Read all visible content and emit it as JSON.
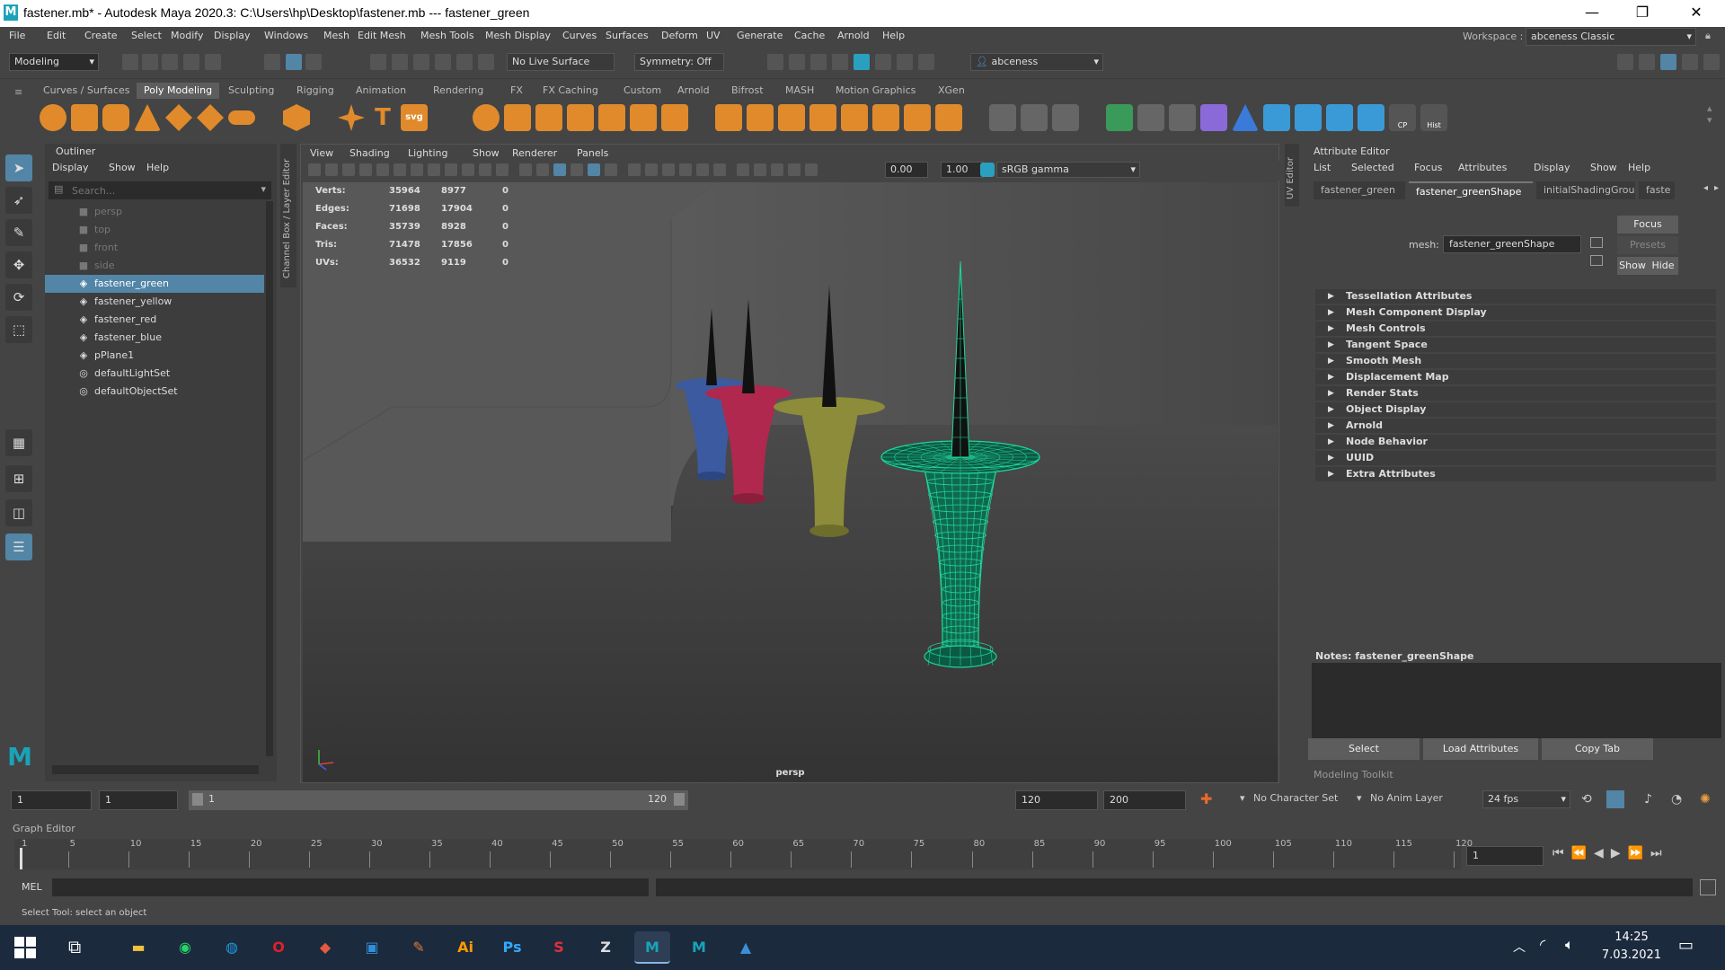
{
  "title_bar": {
    "logo_letter": "M",
    "title": "fastener.mb* - Autodesk Maya 2020.3: C:\\Users\\hp\\Desktop\\fastener.mb   ---   fastener_green",
    "minimize": "—",
    "maximize": "❐",
    "close": "✕"
  },
  "menubar": [
    "File",
    "Edit",
    "Create",
    "Select",
    "Modify",
    "Display",
    "Windows",
    "Mesh",
    "Edit Mesh",
    "Mesh Tools",
    "Mesh Display",
    "Curves",
    "Surfaces",
    "Deform",
    "UV",
    "Generate",
    "Cache",
    "Arnold",
    "Help"
  ],
  "workspace": {
    "label": "Workspace :",
    "value": "abceness Classic"
  },
  "status_line": {
    "mode": "Modeling",
    "live_surface": "No Live Surface",
    "symmetry": "Symmetry: Off",
    "user": "abceness"
  },
  "shelf_tabs": [
    "Curves / Surfaces",
    "Poly Modeling",
    "Sculpting",
    "Rigging",
    "Animation",
    "Rendering",
    "FX",
    "FX Caching",
    "Custom",
    "Arnold",
    "Bifrost",
    "MASH",
    "Motion Graphics",
    "XGen"
  ],
  "shelf_active": "Poly Modeling",
  "shelf_labels": {
    "cp": "CP",
    "hist": "Hist",
    "svg": "svg",
    "text": "T"
  },
  "side_labels": {
    "channel_box": "Channel Box / Layer Editor",
    "uv_editor": "UV Editor"
  },
  "outliner": {
    "title": "Outliner",
    "menu": [
      "Display",
      "Show",
      "Help"
    ],
    "search_placeholder": "Search...",
    "items": [
      {
        "label": "persp",
        "type": "camera"
      },
      {
        "label": "top",
        "type": "camera"
      },
      {
        "label": "front",
        "type": "camera"
      },
      {
        "label": "side",
        "type": "camera"
      },
      {
        "label": "fastener_green",
        "type": "mesh",
        "selected": true
      },
      {
        "label": "fastener_yellow",
        "type": "mesh"
      },
      {
        "label": "fastener_red",
        "type": "mesh"
      },
      {
        "label": "fastener_blue",
        "type": "mesh"
      },
      {
        "label": "pPlane1",
        "type": "mesh"
      },
      {
        "label": "defaultLightSet",
        "type": "set"
      },
      {
        "label": "defaultObjectSet",
        "type": "set"
      }
    ]
  },
  "viewport": {
    "menu": [
      "View",
      "Shading",
      "Lighting",
      "Show",
      "Renderer",
      "Panels"
    ],
    "exposure": "0.00",
    "gamma": "1.00",
    "color_space": "sRGB gamma",
    "camera_label": "persp",
    "hud": [
      {
        "label": "Verts:",
        "a": "35964",
        "b": "8977",
        "c": "0"
      },
      {
        "label": "Edges:",
        "a": "71698",
        "b": "17904",
        "c": "0"
      },
      {
        "label": "Faces:",
        "a": "35739",
        "b": "8928",
        "c": "0"
      },
      {
        "label": "Tris:",
        "a": "71478",
        "b": "17856",
        "c": "0"
      },
      {
        "label": "UVs:",
        "a": "36532",
        "b": "9119",
        "c": "0"
      }
    ],
    "fastener_colors": {
      "blue": "#3c5aa0",
      "red": "#b0284e",
      "yellow": "#8c8c3a",
      "green": "#22d49a"
    }
  },
  "attribute_editor": {
    "title": "Attribute Editor",
    "menu": [
      "List",
      "Selected",
      "Focus",
      "Attributes",
      "Display",
      "Show",
      "Help"
    ],
    "tabs": [
      "fastener_green",
      "fastener_greenShape",
      "initialShadingGroup",
      "faste"
    ],
    "active_tab": "fastener_greenShape",
    "mesh_label": "mesh:",
    "mesh_value": "fastener_greenShape",
    "focus": "Focus",
    "presets": "Presets",
    "show": "Show",
    "hide": "Hide",
    "sections": [
      "Tessellation Attributes",
      "Mesh Component Display",
      "Mesh Controls",
      "Tangent Space",
      "Smooth Mesh",
      "Displacement Map",
      "Render Stats",
      "Object Display",
      "Arnold",
      "Node Behavior",
      "UUID",
      "Extra Attributes"
    ],
    "notes_label": "Notes:  fastener_greenShape",
    "buttons": [
      "Select",
      "Load Attributes",
      "Copy Tab"
    ],
    "modeling_toolkit": "Modeling Toolkit"
  },
  "time_slider": {
    "start": "1",
    "current_start": "1",
    "range_start": "1",
    "range_end_inner": "120",
    "range_end": "120",
    "anim_end": "200",
    "character_set": "No Character Set",
    "anim_layer": "No Anim Layer",
    "fps": "24 fps"
  },
  "graph_editor": {
    "label": "Graph Editor",
    "ticks": [
      "1",
      "5",
      "10",
      "15",
      "20",
      "25",
      "30",
      "35",
      "40",
      "45",
      "50",
      "55",
      "60",
      "65",
      "70",
      "75",
      "80",
      "85",
      "90",
      "95",
      "100",
      "105",
      "110",
      "115",
      "120"
    ],
    "current_frame": "1"
  },
  "command_line": {
    "label": "MEL"
  },
  "help_line": "Select Tool: select an object",
  "taskbar": {
    "time": "14:25",
    "date": "7.03.2021",
    "apps": [
      {
        "name": "file-explorer",
        "glyph": "▬",
        "color": "#f3c13a"
      },
      {
        "name": "whatsapp",
        "glyph": "◉",
        "color": "#25d366"
      },
      {
        "name": "edge",
        "glyph": "◍",
        "color": "#1e9be0"
      },
      {
        "name": "opera",
        "glyph": "O",
        "color": "#e0202a"
      },
      {
        "name": "sketch-app",
        "glyph": "◆",
        "color": "#e55a3c"
      },
      {
        "name": "bracket-app",
        "glyph": "▣",
        "color": "#2f8fd8"
      },
      {
        "name": "pen-app",
        "glyph": "✎",
        "color": "#e07a3a"
      },
      {
        "name": "illustrator",
        "glyph": "Ai",
        "color": "#ff9a00"
      },
      {
        "name": "photoshop",
        "glyph": "Ps",
        "color": "#31a8ff"
      },
      {
        "name": "s-app",
        "glyph": "S",
        "color": "#e0303a"
      },
      {
        "name": "zbrush",
        "glyph": "Z",
        "color": "#dddddd"
      },
      {
        "name": "maya-1",
        "glyph": "M",
        "color": "#1aa3b8"
      },
      {
        "name": "maya-2",
        "glyph": "M",
        "color": "#1aa3b8"
      },
      {
        "name": "photos",
        "glyph": "▲",
        "color": "#3a8fd8"
      }
    ]
  }
}
